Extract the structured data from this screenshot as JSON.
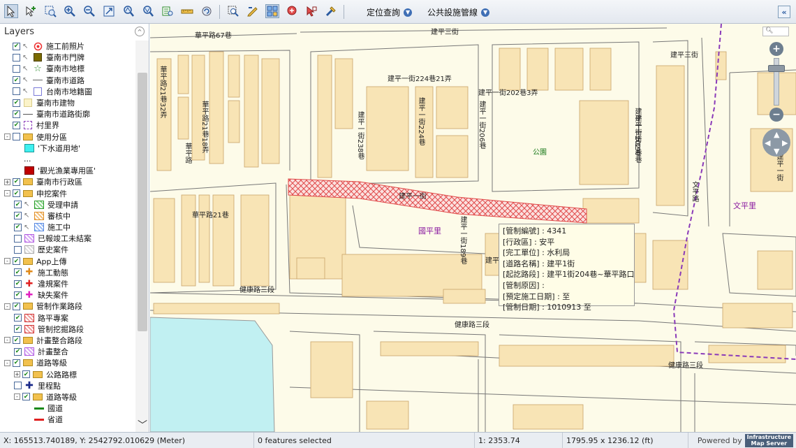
{
  "toolbar": {
    "menus": [
      {
        "label": "定位查詢"
      },
      {
        "label": "公共設施管線"
      }
    ]
  },
  "layers": {
    "title": "Layers",
    "items": [
      {
        "label": "施工前照片",
        "indent": 0,
        "checked": true,
        "symbol": "target-icon"
      },
      {
        "label": "臺南市門牌",
        "indent": 0,
        "checked": false,
        "symbol": "olive-square-icon"
      },
      {
        "label": "臺南市地標",
        "indent": 0,
        "checked": false,
        "symbol": "green-star-icon"
      },
      {
        "label": "臺南市道路",
        "indent": 0,
        "checked": true,
        "symbol": "line-icon"
      },
      {
        "label": "台南市地籍圖",
        "indent": 0,
        "checked": false,
        "symbol": "outline-square-icon"
      },
      {
        "label": "臺南市建物",
        "indent": 0,
        "checked": true,
        "symbol": "cream-square-icon"
      },
      {
        "label": "臺南市道路街廓",
        "indent": 0,
        "checked": true,
        "symbol": "dash-line-icon"
      },
      {
        "label": "村里界",
        "indent": 0,
        "checked": true,
        "symbol": "purple-dash-icon"
      },
      {
        "label": "使用分區",
        "indent": 0,
        "checked": false,
        "symbol": "folder-icon",
        "expand": "-"
      },
      {
        "label": "'下水道用地'",
        "indent": 1,
        "checked": null,
        "symbol": "cyan-square-icon"
      },
      {
        "label": "...",
        "indent": 1,
        "checked": null,
        "symbol": ""
      },
      {
        "label": "'觀光漁業專用區'",
        "indent": 1,
        "checked": null,
        "symbol": "red-square-icon"
      },
      {
        "label": "臺南市行政區",
        "indent": 0,
        "checked": true,
        "symbol": "folder-icon",
        "expand": "+"
      },
      {
        "label": "申挖案件",
        "indent": 0,
        "checked": true,
        "symbol": "folder-icon",
        "expand": "-"
      },
      {
        "label": "受理申請",
        "indent": 1,
        "checked": true,
        "symbol": "green-hatch-icon"
      },
      {
        "label": "審核中",
        "indent": 1,
        "checked": true,
        "symbol": "orange-hatch-icon"
      },
      {
        "label": "施工中",
        "indent": 1,
        "checked": true,
        "symbol": "blue-hatch-icon"
      },
      {
        "label": "已報竣工未結案",
        "indent": 1,
        "checked": false,
        "symbol": "purple-hatch-icon"
      },
      {
        "label": "歷史案件",
        "indent": 1,
        "checked": false,
        "symbol": "grey-hatch-icon"
      },
      {
        "label": "App上傳",
        "indent": 0,
        "checked": true,
        "symbol": "folder-icon",
        "expand": "-"
      },
      {
        "label": "施工動態",
        "indent": 1,
        "checked": true,
        "symbol": "orange-cross-icon"
      },
      {
        "label": "違規案件",
        "indent": 1,
        "checked": true,
        "symbol": "red-cross-icon"
      },
      {
        "label": "缺失案件",
        "indent": 1,
        "checked": true,
        "symbol": "magenta-cross-icon"
      },
      {
        "label": "管制作業路段",
        "indent": 0,
        "checked": true,
        "symbol": "folder-icon",
        "expand": "-"
      },
      {
        "label": "路平專案",
        "indent": 1,
        "checked": true,
        "symbol": "red-hatch-icon"
      },
      {
        "label": "管制挖掘路段",
        "indent": 1,
        "checked": true,
        "symbol": "red-hatch-icon"
      },
      {
        "label": "計畫整合路段",
        "indent": 0,
        "checked": true,
        "symbol": "folder-icon",
        "expand": "-"
      },
      {
        "label": "計畫整合",
        "indent": 1,
        "checked": true,
        "symbol": "purple-hatch-icon"
      },
      {
        "label": "道路等級",
        "indent": 0,
        "checked": true,
        "symbol": "folder-icon",
        "expand": "-"
      },
      {
        "label": "公路路標",
        "indent": 1,
        "checked": true,
        "symbol": "folder-icon",
        "expand": "+"
      },
      {
        "label": "里程點",
        "indent": 1,
        "checked": false,
        "symbol": "navy-plus-icon"
      },
      {
        "label": "道路等級",
        "indent": 1,
        "checked": true,
        "symbol": "folder-icon",
        "expand": "-"
      },
      {
        "label": "國道",
        "indent": 2,
        "checked": null,
        "symbol": "green-line-icon"
      },
      {
        "label": "省道",
        "indent": 2,
        "checked": null,
        "symbol": "red-line-icon"
      }
    ]
  },
  "map": {
    "labels": [
      {
        "text": "建平三街",
        "cls": ""
      },
      {
        "text": "建平三街",
        "cls": ""
      },
      {
        "text": "華平路67巷",
        "cls": ""
      },
      {
        "text": "建平一街202巷3弄",
        "cls": ""
      },
      {
        "text": "建平一街224巷21弄",
        "cls": ""
      },
      {
        "text": "華平路21巷32弄",
        "cls": "v"
      },
      {
        "text": "華平路21巷18弄",
        "cls": "v"
      },
      {
        "text": "建平一街238巷",
        "cls": "v"
      },
      {
        "text": "建平一街224巷",
        "cls": "v"
      },
      {
        "text": "建平一街206巷",
        "cls": "v"
      },
      {
        "text": "建平一街202巷",
        "cls": "v"
      },
      {
        "text": "建平一街190巷",
        "cls": "v"
      },
      {
        "text": "華平路",
        "cls": "v"
      },
      {
        "text": "公園",
        "cls": "park"
      },
      {
        "text": "建平一街",
        "cls": ""
      },
      {
        "text": "華平路21巷",
        "cls": ""
      },
      {
        "text": "國平里",
        "cls": "village"
      },
      {
        "text": "建平一街189巷",
        "cls": "v"
      },
      {
        "text": "建平一街",
        "cls": ""
      },
      {
        "text": "健康路三段",
        "cls": ""
      },
      {
        "text": "健康路三段",
        "cls": ""
      },
      {
        "text": "健康路三段",
        "cls": ""
      },
      {
        "text": "文平路",
        "cls": "v"
      },
      {
        "text": "文平里",
        "cls": "village"
      },
      {
        "text": "建平一街",
        "cls": "v"
      }
    ],
    "search_placeholder": "",
    "popup": [
      "[管制編號] : 4341",
      "[行政區] : 安平",
      "[完工單位] : 水利局",
      "[道路名稱] : 建平1街",
      "[起訖路段] : 建平1街204巷~華平路口",
      "[管制原因] :",
      "[預定施工日期] : 至",
      "[管制日期] : 1010913 至"
    ]
  },
  "status": {
    "coords": "X: 165513.740189, Y: 2542792.010629 (Meter)",
    "selected": "0 features selected",
    "scale": "1: 2353.74",
    "extent": "1795.95 x 1236.12 (ft)",
    "powered_by": "Powered by",
    "logo_line1": "Infrastructure",
    "logo_line2": "Map Server"
  }
}
